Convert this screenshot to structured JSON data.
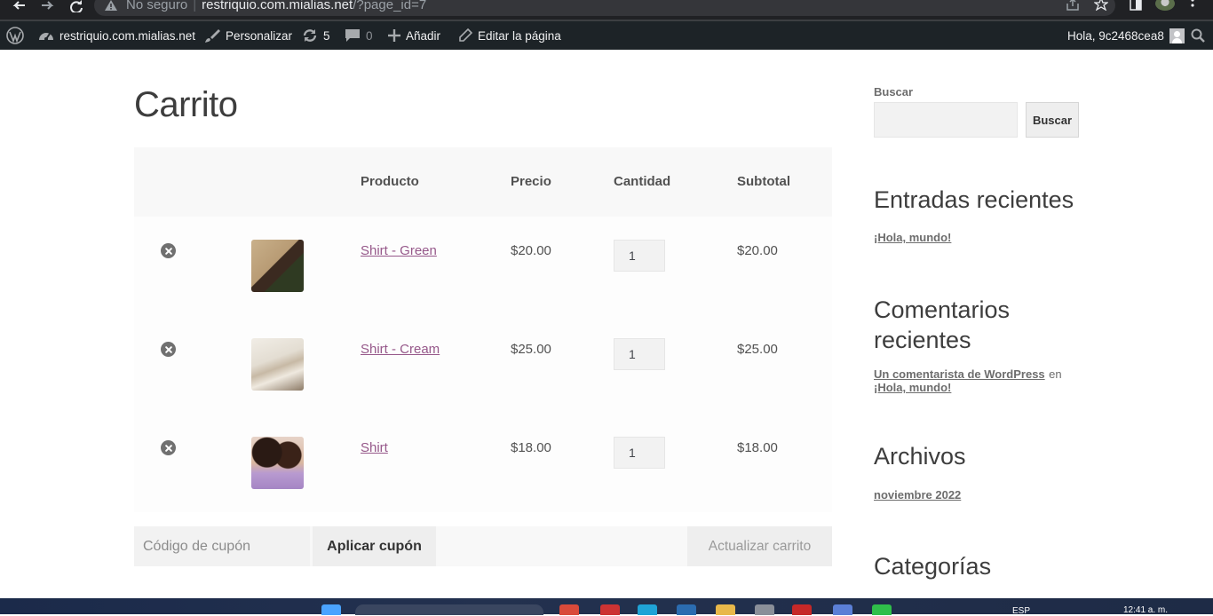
{
  "browser": {
    "security": "No seguro",
    "host": "restriquio.com.mialias.net",
    "path": "/?page_id=7",
    "icons": [
      "back-icon",
      "forward-icon",
      "reload-icon",
      "warning-icon",
      "share-icon",
      "star-icon",
      "sidepanel-icon",
      "profile-avatar",
      "menu-dots-icon"
    ]
  },
  "adminbar": {
    "site": "restriquio.com.mialias.net",
    "customize": "Personalizar",
    "updates": "5",
    "comments": "0",
    "add": "Añadir",
    "edit": "Editar la página",
    "greeting": "Hola, 9c2468cea8"
  },
  "page": {
    "title": "Carrito"
  },
  "cart": {
    "headers": {
      "product": "Producto",
      "price": "Precio",
      "quantity": "Cantidad",
      "subtotal": "Subtotal"
    },
    "items": [
      {
        "name": "Shirt - Green",
        "price": "$20.00",
        "qty": "1",
        "subtotal": "$20.00",
        "thumb_colors": [
          "#3b2a20",
          "#c9b08a",
          "#2f3a22"
        ]
      },
      {
        "name": "Shirt - Cream",
        "price": "$25.00",
        "qty": "1",
        "subtotal": "$25.00",
        "thumb_colors": [
          "#e9e4da",
          "#c7b9a5",
          "#8c7a66"
        ]
      },
      {
        "name": "Shirt",
        "price": "$18.00",
        "qty": "1",
        "subtotal": "$18.00",
        "thumb_colors": [
          "#2a1a14",
          "#b89ad0",
          "#d9b7a0"
        ]
      }
    ],
    "coupon_placeholder": "Código de cupón",
    "apply_coupon": "Aplicar cupón",
    "update_cart": "Actualizar carrito"
  },
  "sidebar": {
    "search_label": "Buscar",
    "search_button": "Buscar",
    "recent_posts_title": "Entradas recientes",
    "recent_post": "¡Hola, mundo!",
    "recent_comments_title_1": "Comentarios",
    "recent_comments_title_2": "recientes",
    "comment_author": "Un comentarista de WordPress",
    "comment_on": "en",
    "comment_post": "¡Hola, mundo!",
    "archives_title": "Archivos",
    "archive_month": "noviembre 2022",
    "categories_title": "Categorías"
  },
  "taskbar": {
    "lang": "ESP",
    "time": "12:41 a. m."
  },
  "colors": {
    "link": "#96588a",
    "adminbar": "#1d2327",
    "chrome": "#202124"
  }
}
